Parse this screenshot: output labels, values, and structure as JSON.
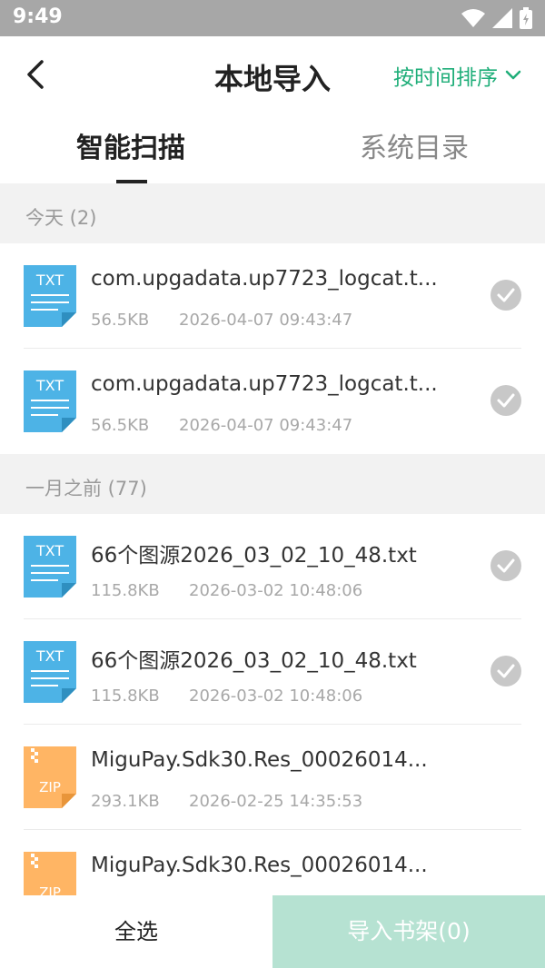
{
  "status_bar": {
    "time": "9:49",
    "icons": [
      "wifi-icon",
      "signal-icon",
      "battery-icon"
    ]
  },
  "nav": {
    "title": "本地导入",
    "sort_label": "按时间排序",
    "back_icon": "back-arrow-icon"
  },
  "tabs": [
    {
      "label": "智能扫描",
      "active": true
    },
    {
      "label": "系统目录",
      "active": false
    }
  ],
  "sections": [
    {
      "title": "今天 (2)",
      "files": [
        {
          "type": "TXT",
          "name": "com.upgadata.up7723_logcat.t...",
          "size": "56.5KB",
          "date": "2026-04-07 09:43:47",
          "selectable": true
        },
        {
          "type": "TXT",
          "name": "com.upgadata.up7723_logcat.t...",
          "size": "56.5KB",
          "date": "2026-04-07 09:43:47",
          "selectable": true
        }
      ]
    },
    {
      "title": "一月之前 (77)",
      "files": [
        {
          "type": "TXT",
          "name": "66个图源2026_03_02_10_48.txt",
          "size": "115.8KB",
          "date": "2026-03-02 10:48:06",
          "selectable": true
        },
        {
          "type": "TXT",
          "name": "66个图源2026_03_02_10_48.txt",
          "size": "115.8KB",
          "date": "2026-03-02 10:48:06",
          "selectable": true
        },
        {
          "type": "ZIP",
          "name": "MiguPay.Sdk30.Res_00026014...",
          "size": "293.1KB",
          "date": "2026-02-25 14:35:53",
          "selectable": false
        },
        {
          "type": "ZIP",
          "name": "MiguPay.Sdk30.Res_00026014...",
          "size": "",
          "date": "",
          "selectable": false
        }
      ]
    }
  ],
  "bottom": {
    "select_all": "全选",
    "import_button": "导入书架(0)"
  },
  "colors": {
    "accent": "#1fae79",
    "txt_icon": "#4db3e6",
    "zip_icon": "#ffb564",
    "import_disabled": "#b6e2d2",
    "check": "#c8c8c8"
  }
}
